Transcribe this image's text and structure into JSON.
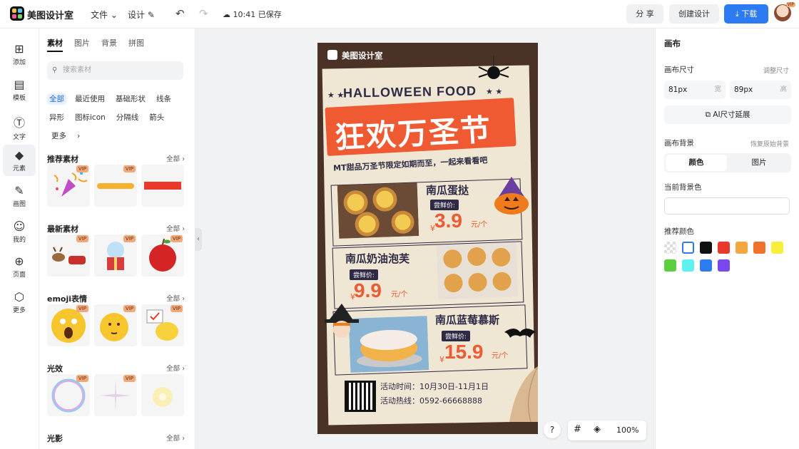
{
  "header": {
    "app_title": "美图设计室",
    "menu_file": "文件",
    "menu_design": "设计",
    "save_status": "10:41 已保存",
    "share_label": "分 享",
    "create_label": "创建设计",
    "download_label": "下载",
    "avatar_badge": "VIP"
  },
  "rail": {
    "items": [
      {
        "label": "添加",
        "icon": "plus-icon"
      },
      {
        "label": "模板",
        "icon": "template-icon"
      },
      {
        "label": "文字",
        "icon": "text-icon"
      },
      {
        "label": "元素",
        "icon": "elements-icon"
      },
      {
        "label": "画图",
        "icon": "draw-icon"
      },
      {
        "label": "我的",
        "icon": "user-icon"
      },
      {
        "label": "页面",
        "icon": "page-icon"
      },
      {
        "label": "更多",
        "icon": "more-icon"
      }
    ]
  },
  "panel": {
    "tabs": [
      "素材",
      "图片",
      "背景",
      "拼图"
    ],
    "search_placeholder": "搜索素材",
    "filters": [
      "全部",
      "最近使用",
      "基础形状",
      "线条",
      "异形",
      "图标icon",
      "分隔线",
      "箭头",
      "更多"
    ],
    "see_all": "全部",
    "vip": "VIP",
    "sections": [
      "推荐素材",
      "最新素材",
      "emoji表情",
      "光效",
      "光影"
    ]
  },
  "poster": {
    "logo_text": "美图设计室",
    "headline_en": "HALLOWEEN FOOD",
    "headline_cn": "狂欢万圣节",
    "subtitle": "MT甜品万圣节限定如期而至，一起来看看吧",
    "price_tag": "尝鲜价:",
    "unit": "元/个",
    "currency": "¥",
    "items": [
      {
        "name": "南瓜蛋挞",
        "price": "3.9"
      },
      {
        "name": "南瓜奶油泡芙",
        "price": "9.9"
      },
      {
        "name": "南瓜蓝莓慕斯",
        "price": "15.9"
      }
    ],
    "event_time": "活动时间：10月30日-11月1日",
    "event_hotline": "活动热线：0592-66668888"
  },
  "zoom": {
    "help": "?",
    "level": "100%"
  },
  "right_panel": {
    "title": "画布",
    "size_label": "画布尺寸",
    "adjust_size": "调整尺寸",
    "width_value": "81px",
    "width_unit": "宽",
    "height_value": "89px",
    "height_unit": "高",
    "ai_expand": "AI尺寸延展",
    "bg_label": "画布背景",
    "restore_bg": "恢复原始背景",
    "tab_color": "颜色",
    "tab_image": "图片",
    "current_bg_label": "当前背景色",
    "recommended_label": "推荐颜色",
    "swatches": [
      "transparent",
      "#ffffff",
      "#111111",
      "#e8392b",
      "#f4a640",
      "#f0722d",
      "#f8ef3c",
      "#5ccf3e",
      "#5ef2ef",
      "#2f7bf0",
      "#7b48ef"
    ]
  }
}
